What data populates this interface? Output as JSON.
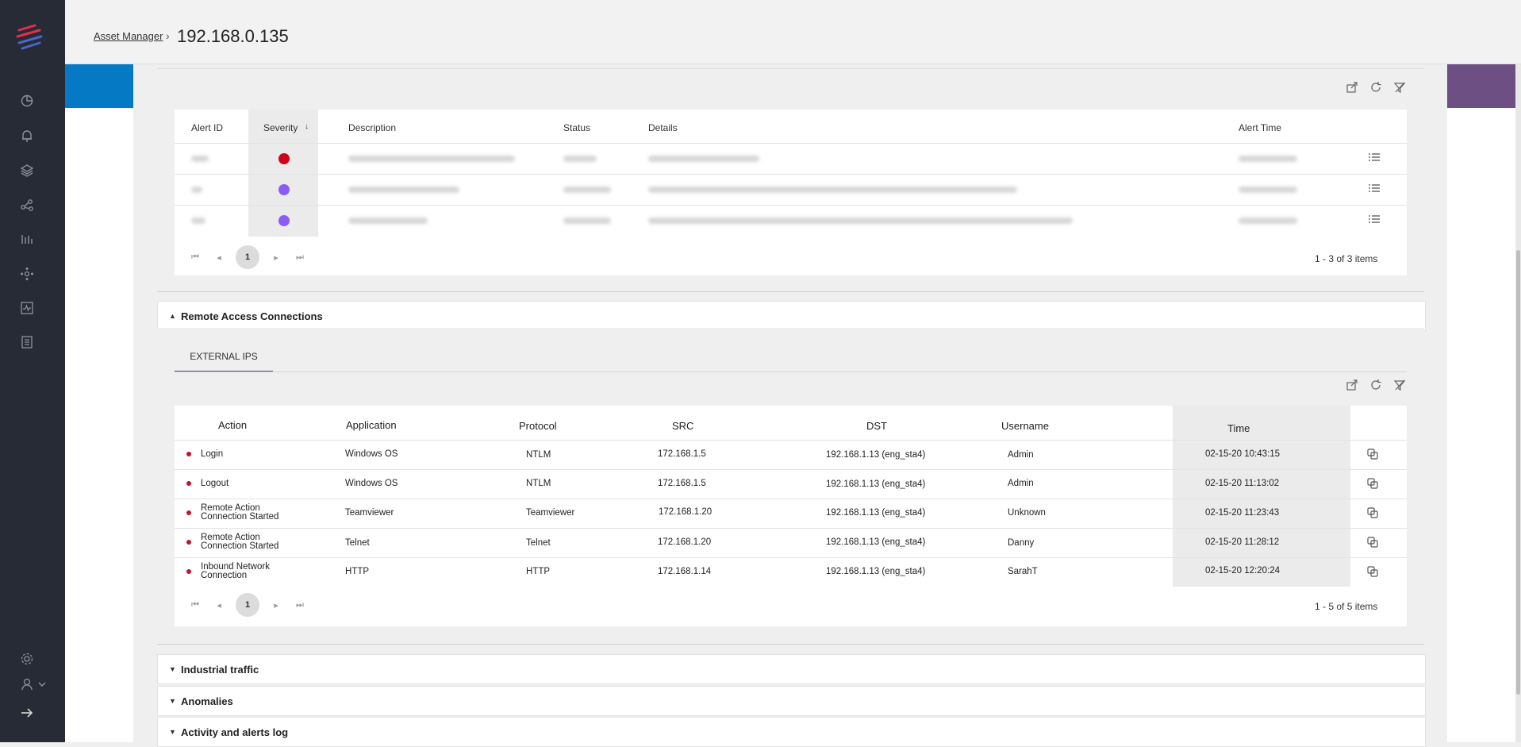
{
  "breadcrumb": {
    "link": "Asset Manager",
    "separator": "›",
    "title": "192.168.0.135"
  },
  "alerts": {
    "headers": {
      "id": "Alert ID",
      "severity": "Severity",
      "description": "Description",
      "status": "Status",
      "details": "Details",
      "time": "Alert Time"
    },
    "sort_indicator": "↓",
    "rows": [
      {
        "severity_color": "#d0021b"
      },
      {
        "severity_color": "#8b5cf6"
      },
      {
        "severity_color": "#8b5cf6"
      }
    ],
    "pager": {
      "first": "⏮",
      "prev": "◂",
      "page": "1",
      "next": "▸",
      "last": "⏭"
    },
    "count": "1 - 3 of 3 items"
  },
  "remote_access": {
    "title": "Remote Access Connections",
    "tab": "EXTERNAL IPS",
    "headers": {
      "action": "Action",
      "application": "Application",
      "protocol": "Protocol",
      "src": "SRC",
      "dst": "DST",
      "username": "Username",
      "time": "Time"
    },
    "rows": [
      {
        "action": "Login",
        "application": "Windows OS",
        "protocol": "NTLM",
        "src": "172.168.1.5",
        "dst": "192.168.1.13 (eng_sta4)",
        "username": "Admin",
        "time": "02-15-20 10:43:15"
      },
      {
        "action": "Logout",
        "application": "Windows OS",
        "protocol": "NTLM",
        "src": "172.168.1.5",
        "dst": "192.168.1.13 (eng_sta4)",
        "username": "Admin",
        "time": "02-15-20 11:13:02"
      },
      {
        "action": "Remote Action Connection Started",
        "application": "Teamviewer",
        "protocol": "Teamviewer",
        "src": "172.168.1.20",
        "dst": "192.168.1.13 (eng_sta4)",
        "username": "Unknown",
        "time": "02-15-20 11:23:43"
      },
      {
        "action": "Remote Action Connection Started",
        "application": "Telnet",
        "protocol": "Telnet",
        "src": "172.168.1.20",
        "dst": "192.168.1.13 (eng_sta4)",
        "username": "Danny",
        "time": "02-15-20 11:28:12"
      },
      {
        "action": "Inbound Network Connection",
        "application": "HTTP",
        "protocol": "HTTP",
        "src": "172.168.1.14",
        "dst": "192.168.1.13 (eng_sta4)",
        "username": "SarahT",
        "time": "02-15-20 12:20:24"
      }
    ],
    "pager": {
      "first": "⏮",
      "prev": "◂",
      "page": "1",
      "next": "▸",
      "last": "⏭"
    },
    "count": "1 - 5 of 5 items"
  },
  "sections": {
    "industrial": "Industrial traffic",
    "anomalies": "Anomalies",
    "activity": "Activity and alerts log"
  },
  "icons": {
    "sidebar": [
      "dashboard-icon",
      "bell-icon",
      "layers-icon",
      "network-icon",
      "bar-chart-icon",
      "hub-icon",
      "activity-icon",
      "report-icon",
      "gear-icon",
      "user-icon",
      "logout-icon"
    ],
    "toolbar": [
      "export-icon",
      "refresh-icon",
      "clear-filter-icon"
    ]
  },
  "colors": {
    "sidebar": "#272b36",
    "accent_blue": "#0679c5",
    "accent_purple": "#6d4f83",
    "tab_underline": "#3d4c8f",
    "status_red": "#c8102e"
  }
}
